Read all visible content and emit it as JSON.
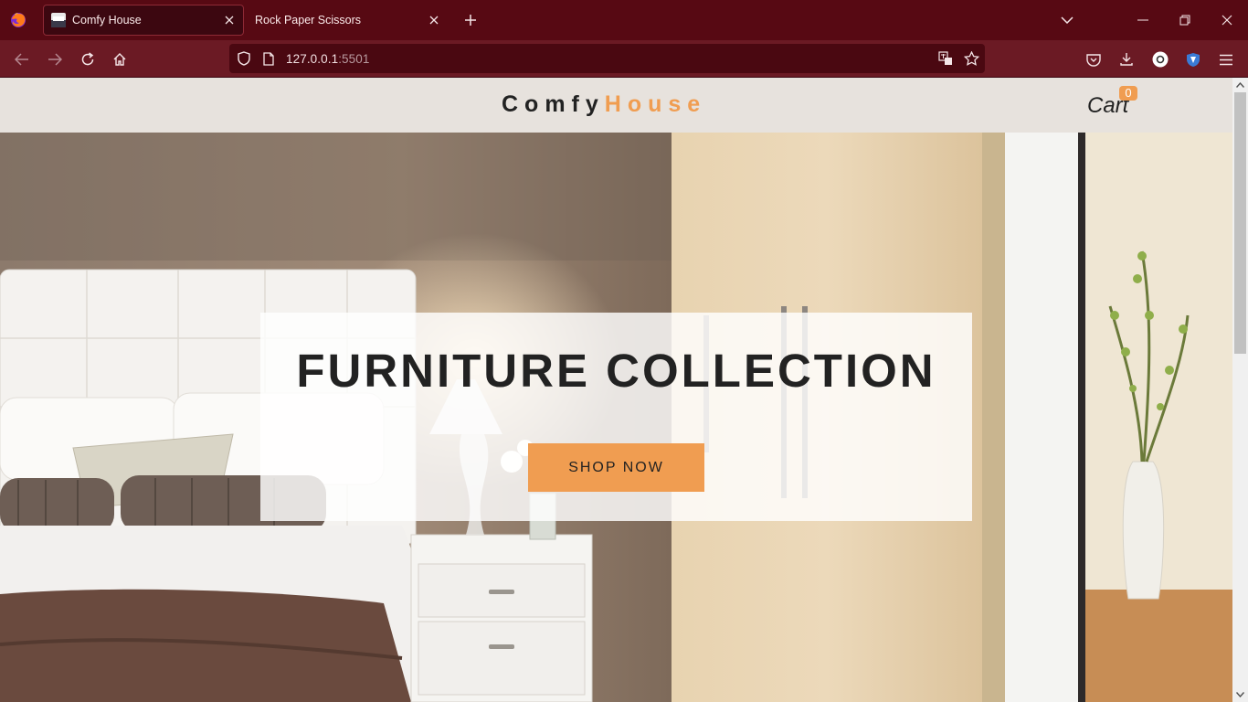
{
  "browser": {
    "tabs": [
      {
        "title": "Comfy House",
        "active": true
      },
      {
        "title": "Rock Paper Scissors",
        "active": false
      }
    ],
    "url": {
      "host": "127.0.0.1",
      "port": ":5501"
    }
  },
  "site": {
    "logo": {
      "part1": "Comfy",
      "part2": "House"
    },
    "cart": {
      "label": "Cart",
      "count": "0"
    },
    "hero": {
      "title": "FURNITURE COLLECTION",
      "button": "SHOP NOW"
    },
    "colors": {
      "accent": "#f09d51",
      "nav_bg": "#e7e2dd",
      "text": "#222222"
    }
  }
}
